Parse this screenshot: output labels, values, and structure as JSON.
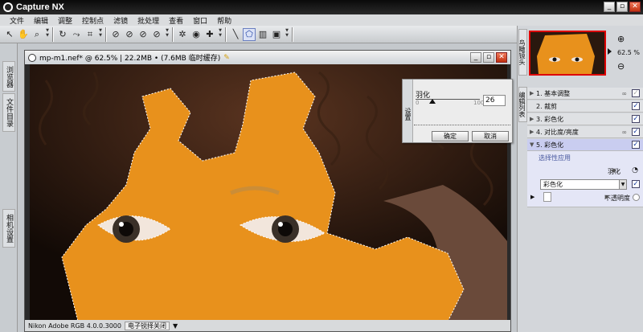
{
  "app": {
    "title": "Capture NX"
  },
  "menu": [
    "文件",
    "编辑",
    "调整",
    "控制点",
    "滤镜",
    "批处理",
    "查看",
    "窗口",
    "帮助"
  ],
  "left_dock": {
    "browser_tab": "浏览器",
    "file_dir_tab": "文件目录",
    "camera_tab": "相机设置"
  },
  "document": {
    "title": "mp-m1.nef* @ 62.5% | 22.2MB • (7.6MB 临时缓存)",
    "status_profile": "Nikon Adobe RGB 4.0.0.3000",
    "status_lens": "电子锐择关闭"
  },
  "settings_panel": {
    "side_label": "设置",
    "feather_label": "羽化",
    "slider_min": "0",
    "slider_max": "100",
    "feather_value": "26",
    "feather_fraction": 0.26,
    "ok": "确定",
    "cancel": "取消"
  },
  "right_dock": {
    "birdseye_tab": "鸟瞰镜头",
    "edit_list_tab": "编辑列表",
    "zoom_level": "62.5 %",
    "steps": [
      {
        "label": "1. 基本调整",
        "checked": false
      },
      {
        "label": "2. 裁剪",
        "checked": true
      },
      {
        "label": "3. 彩色化",
        "checked": true
      },
      {
        "label": "4. 对比度/亮度",
        "checked": true
      },
      {
        "label": "5. 彩色化",
        "checked": true
      }
    ],
    "selective": "选择性应用",
    "feather_label": "羽化",
    "colorize_dropdown": "彩色化",
    "opacity_label": "不透明度"
  },
  "colors": {
    "overlay": "#e8911c",
    "accent": "#1a3ea0",
    "close": "#c23010"
  }
}
